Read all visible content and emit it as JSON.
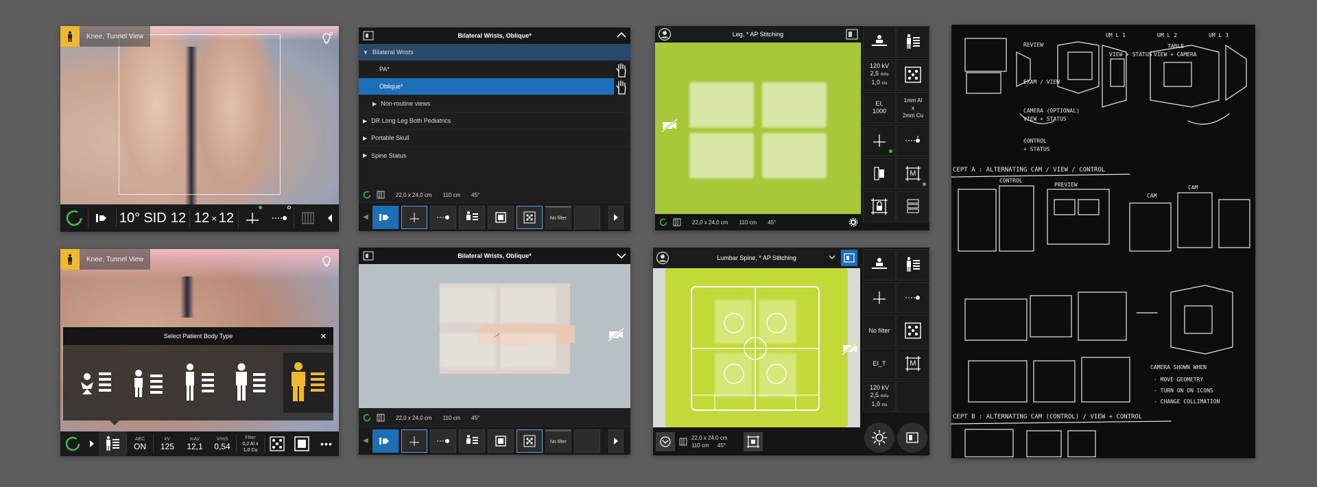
{
  "p1": {
    "label": "Knee, Tunnel View",
    "angle": "10°",
    "sid": "SID",
    "sid_value": "12",
    "field": "12",
    "field_x": "×",
    "field_y": "12"
  },
  "p2": {
    "header": "Bilateral Wrists, Oblique*",
    "group": "Bilateral Wrists",
    "items": [
      "PA*",
      "Oblique*"
    ],
    "nonroutine": "Non-routine views",
    "others": [
      "DR Long Leg Both Pediatrics",
      "Portable Skull",
      "Spine Status"
    ],
    "size": "22,0 x 24,0 cm",
    "distance": "110 cm",
    "tilt": "45°",
    "nofilter": "No filter"
  },
  "p3": {
    "header": "Leg, * AP Stitching",
    "kv": "120 kV",
    "mas": "2,5",
    "mas_unit": "mAs",
    "ms": "1,0",
    "ms_unit": "ms",
    "ei": "EI,",
    "ei_val": "1000",
    "filter_a": "1mm Al",
    "filter_x": "x",
    "filter_b": "2mm Cu",
    "m_label": "M",
    "size": "22,0 x 24,0 cm",
    "distance": "110 cm",
    "tilt": "45°"
  },
  "p4": {
    "label": "Knee, Tunnel View",
    "dialog_title": "Select Patient Body Type",
    "close": "✕",
    "aec_label": "AEC",
    "aec_value": "ON",
    "kv_label": "kV",
    "kv_value": "125",
    "mav_label": "mAV",
    "mav_value": "12,1",
    "vms_label": "V/mS",
    "vms_value": "0,54",
    "filter_label": "Filter",
    "filter_a": "0,2 Al x",
    "filter_b": "1,0 Cu",
    "more": "•••"
  },
  "p5": {
    "header": "Bilateral Wrists, Oblique*",
    "size": "22,0 x 24,0 cm",
    "distance": "110 cm",
    "tilt": "45°",
    "nofilter": "No filter"
  },
  "p6": {
    "header": "Lumbar Spine, * AP Stitching",
    "nofilter": "No filter",
    "ei": "EI_T",
    "m_label": "M",
    "kv": "120 kV",
    "mas": "2,5",
    "mas_unit": "mAs",
    "ms": "1,0",
    "ms_unit": "ms",
    "size": "22,0 x 24,0 cm",
    "distance": "110 cm",
    "tilt": "45°"
  },
  "sketch": {
    "notes": [
      "REVIEW",
      "EXAM / VIEW",
      "CAMERA (OPTIONAL)",
      "VIEW + STATUS",
      "CONTROL",
      "+ STATUS",
      "UM L 1",
      "UM L 2",
      "UM L 3",
      "VIEW + STATUS",
      "VIEW + CAMERA",
      "TABLE",
      "CEPT A : ALTERNATING CAM / VIEW / CONTROL",
      "PREVIEW",
      "CONTROL",
      "CAM",
      "CAM",
      "CAMERA SHOWN WHEN",
      "- MOVE GEOMETRY",
      "- TURN ON ON ICONS",
      "- CHANGE COLLIMATION",
      "CEPT B : ALTERNATING CAM (CONTROL) / VIEW + CONTROL"
    ]
  },
  "colors": {
    "accent_blue": "#1d6fb8",
    "accent_yellow": "#f0b92c",
    "lime": "#a8c83a",
    "status_green": "#3ac24a"
  }
}
